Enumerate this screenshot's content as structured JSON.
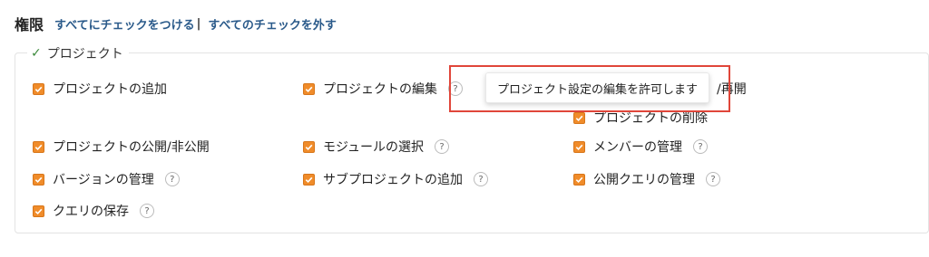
{
  "header": {
    "title": "権限",
    "check_all": "すべてにチェックをつける",
    "separator": "|",
    "uncheck_all": "すべてのチェックを外す"
  },
  "section": {
    "legend": "プロジェクト",
    "items": [
      {
        "label": "プロジェクトの追加",
        "checked": true,
        "help": false
      },
      {
        "label": "プロジェクトの編集",
        "checked": true,
        "help": true
      },
      {
        "label": "/再開",
        "checked": true,
        "help": false
      },
      {
        "label": "プロジェクトの削除",
        "checked": true,
        "help": false
      },
      {
        "label": "プロジェクトの公開/非公開",
        "checked": true,
        "help": false
      },
      {
        "label": "モジュールの選択",
        "checked": true,
        "help": true
      },
      {
        "label": "メンバーの管理",
        "checked": true,
        "help": true
      },
      {
        "label": "バージョンの管理",
        "checked": true,
        "help": true
      },
      {
        "label": "サブプロジェクトの追加",
        "checked": true,
        "help": true
      },
      {
        "label": "公開クエリの管理",
        "checked": true,
        "help": true
      },
      {
        "label": "クエリの保存",
        "checked": true,
        "help": true
      }
    ]
  },
  "tooltip": {
    "text": "プロジェクト設定の編集を許可します"
  },
  "help_glyph": "?",
  "colors": {
    "checkbox": "#f08c2a",
    "link": "#2a5a8a",
    "highlight": "#e0463a",
    "legend_check": "#3d8a3d"
  }
}
